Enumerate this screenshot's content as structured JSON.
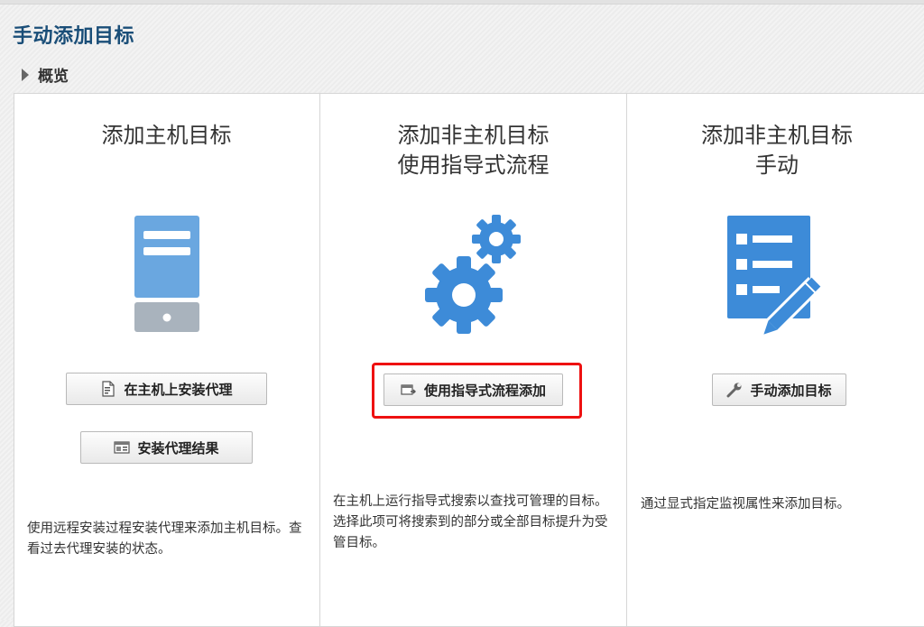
{
  "page": {
    "title": "手动添加目标"
  },
  "overview": {
    "label": "概览"
  },
  "columns": [
    {
      "title_lines": [
        "添加主机目标"
      ],
      "buttons": [
        {
          "label": "在主机上安装代理"
        },
        {
          "label": "安装代理结果"
        }
      ],
      "description": "使用远程安装过程安装代理来添加主机目标。查看过去代理安装的状态。"
    },
    {
      "title_lines": [
        "添加非主机目标",
        "使用指导式流程"
      ],
      "buttons": [
        {
          "label": "使用指导式流程添加"
        }
      ],
      "description": "在主机上运行指导式搜索以查找可管理的目标。选择此项可将搜索到的部分或全部目标提升为受管目标。"
    },
    {
      "title_lines": [
        "添加非主机目标",
        "手动"
      ],
      "buttons": [
        {
          "label": "手动添加目标"
        }
      ],
      "description": "通过显式指定监视属性来添加目标。"
    }
  ],
  "colors": {
    "title": "#1a4e78",
    "icon_blue": "#4a90d9",
    "icon_light_blue": "#6aa7e0",
    "icon_gray": "#a9b3bd",
    "highlight": "#e11111"
  },
  "icons": {
    "server": "server-icon",
    "gears": "gears-icon",
    "form_edit": "form-pencil-icon",
    "agent_install": "document-install-icon",
    "results": "results-icon",
    "guided": "guided-flow-icon",
    "wrench": "wrench-icon"
  }
}
